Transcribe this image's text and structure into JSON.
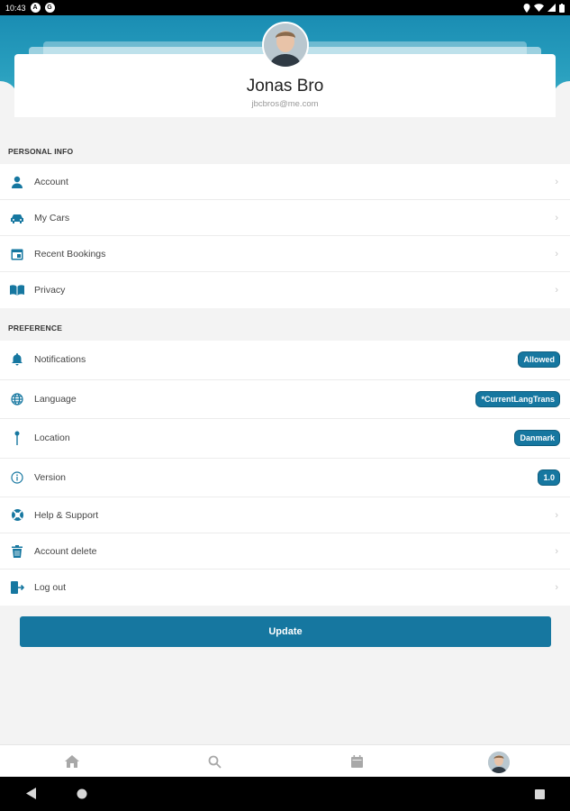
{
  "status_bar": {
    "time": "10:43",
    "icon_a": "A",
    "icon_b": "G"
  },
  "profile": {
    "name": "Jonas Bro",
    "email": "jbcbros@me.com"
  },
  "personal_info": {
    "title": "PERSONAL INFO",
    "items": [
      {
        "label": "Account",
        "icon": "person-icon"
      },
      {
        "label": "My Cars",
        "icon": "car-icon"
      },
      {
        "label": "Recent Bookings",
        "icon": "calendar-icon"
      },
      {
        "label": "Privacy",
        "icon": "book-icon"
      }
    ]
  },
  "preference": {
    "title": "PREFERENCE",
    "items": [
      {
        "label": "Notifications",
        "icon": "bell-icon",
        "badge": "Allowed"
      },
      {
        "label": "Language",
        "icon": "globe-icon",
        "badge": "*CurrentLangTrans"
      },
      {
        "label": "Location",
        "icon": "pin-icon",
        "badge": "Danmark"
      },
      {
        "label": "Version",
        "icon": "info-icon",
        "badge": "1.0"
      },
      {
        "label": "Help & Support",
        "icon": "lifebuoy-icon"
      },
      {
        "label": "Account delete",
        "icon": "trash-icon"
      },
      {
        "label": "Log out",
        "icon": "logout-icon"
      }
    ]
  },
  "update_button": {
    "label": "Update"
  },
  "colors": {
    "accent": "#1677a0",
    "hero": "#2aa0bf",
    "background": "#f3f3f3"
  }
}
